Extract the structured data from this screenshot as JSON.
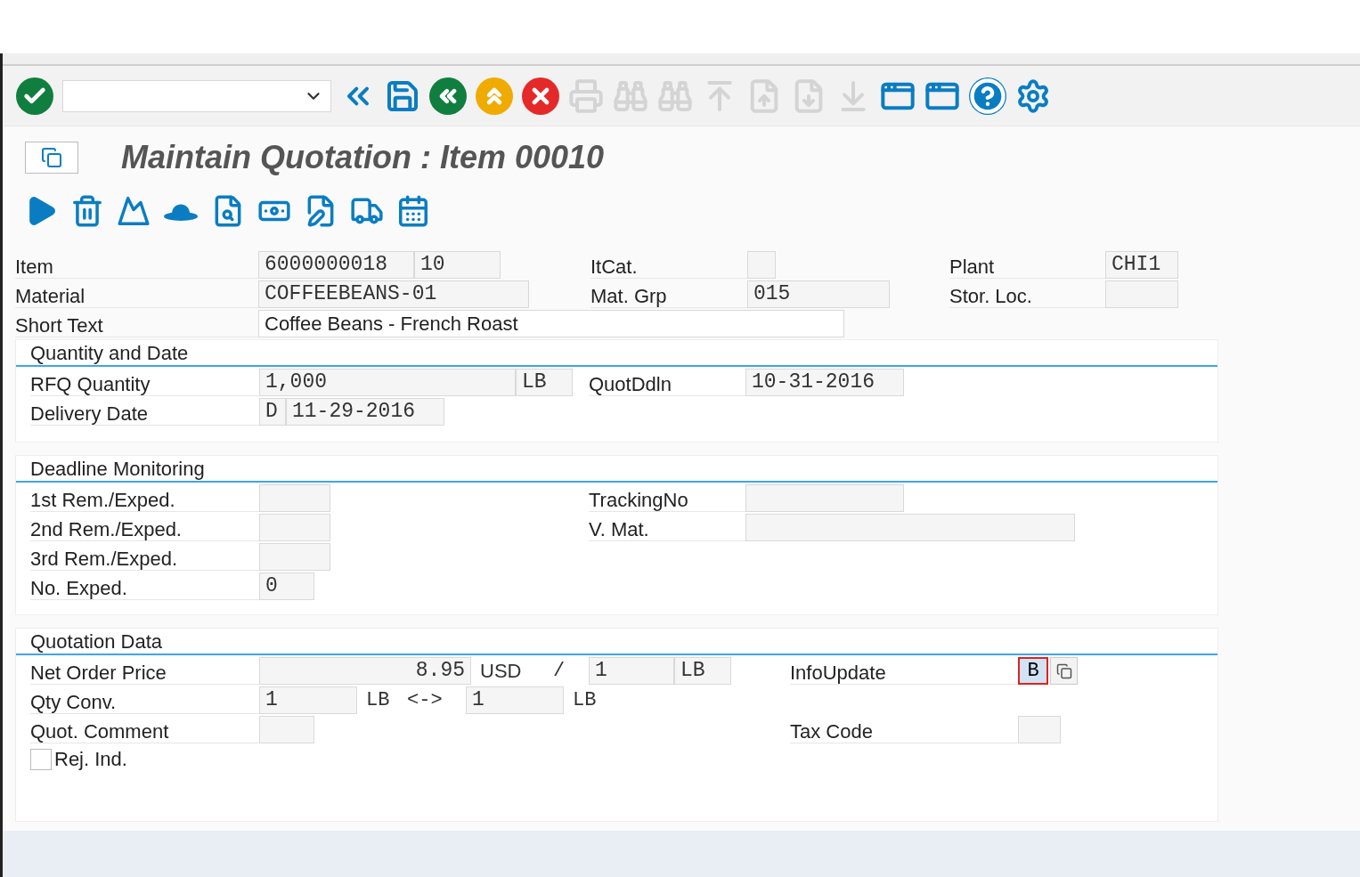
{
  "toolbar": {
    "buttons": [
      {
        "kind": "enter",
        "disabled": false
      },
      {
        "kind": "command",
        "disabled": false
      },
      {
        "kind": "back2",
        "disabled": false
      },
      {
        "kind": "save",
        "disabled": false
      },
      {
        "kind": "back",
        "disabled": false
      },
      {
        "kind": "exit",
        "disabled": false
      },
      {
        "kind": "cancel",
        "disabled": false
      },
      {
        "kind": "print",
        "disabled": true
      },
      {
        "kind": "find",
        "disabled": true
      },
      {
        "kind": "findnext",
        "disabled": true
      },
      {
        "kind": "first",
        "disabled": true
      },
      {
        "kind": "prev",
        "disabled": true
      },
      {
        "kind": "next",
        "disabled": true
      },
      {
        "kind": "last",
        "disabled": true
      },
      {
        "kind": "newsession",
        "disabled": false
      },
      {
        "kind": "shortcut",
        "disabled": false
      },
      {
        "kind": "help",
        "disabled": false
      },
      {
        "kind": "settings",
        "disabled": false
      }
    ]
  },
  "title": "Maintain Quotation : Item 00010",
  "app_toolbar": [
    {
      "kind": "play"
    },
    {
      "kind": "trash"
    },
    {
      "kind": "mountain"
    },
    {
      "kind": "hat"
    },
    {
      "kind": "search"
    },
    {
      "kind": "money"
    },
    {
      "kind": "edit"
    },
    {
      "kind": "truck"
    },
    {
      "kind": "calendar"
    }
  ],
  "header": {
    "item": {
      "label": "Item",
      "values": [
        "6000000018",
        "10"
      ]
    },
    "itcat": {
      "label": "ItCat."
    },
    "plant": {
      "label": "Plant",
      "value": "CHI1"
    },
    "material": {
      "label": "Material",
      "value": "COFFEEBEANS-01"
    },
    "mat_grp": {
      "label": "Mat. Grp",
      "value": "015"
    },
    "stor_loc": {
      "label": "Stor. Loc."
    },
    "short_text": {
      "label": "Short Text",
      "value": "Coffee Beans - French Roast"
    }
  },
  "quantity_and_date": {
    "title": "Quantity and Date",
    "rfq_quantity": {
      "label": "RFQ Quantity",
      "value": "1,000",
      "unit": "LB"
    },
    "quot_ddln": {
      "label": "QuotDdln",
      "value": "10-31-2016"
    },
    "delivery_date": {
      "label": "Delivery Date",
      "format": "D",
      "value": "11-29-2016"
    }
  },
  "deadline_monitoring": {
    "title": "Deadline Monitoring",
    "fields": [
      {
        "label": "1st Rem./Exped."
      },
      {
        "label": "2nd Rem./Exped."
      },
      {
        "label": "3rd Rem./Exped."
      },
      {
        "label": "No. Exped.",
        "value": "0"
      }
    ],
    "tracking_no": {
      "label": "TrackingNo"
    },
    "v_mat": {
      "label": "V. Mat."
    }
  },
  "quotation_data": {
    "title": "Quotation Data",
    "net_order_price": {
      "label": "Net Order Price",
      "value": "8.95",
      "currency": "USD",
      "separator": "/",
      "per": "1",
      "unit": "LB"
    },
    "info_update": {
      "label": "InfoUpdate",
      "value": "B",
      "focused": true
    },
    "qty_conv": {
      "label": "Qty Conv.",
      "value": "1",
      "unit": "LB",
      "separator": "<->",
      "value2": "1",
      "unit2": "LB"
    },
    "quot_comment": {
      "label": "Quot. Comment"
    },
    "tax_code": {
      "label": "Tax Code"
    },
    "rej_ind": {
      "label": "Rej. Ind.",
      "checked": false
    }
  }
}
